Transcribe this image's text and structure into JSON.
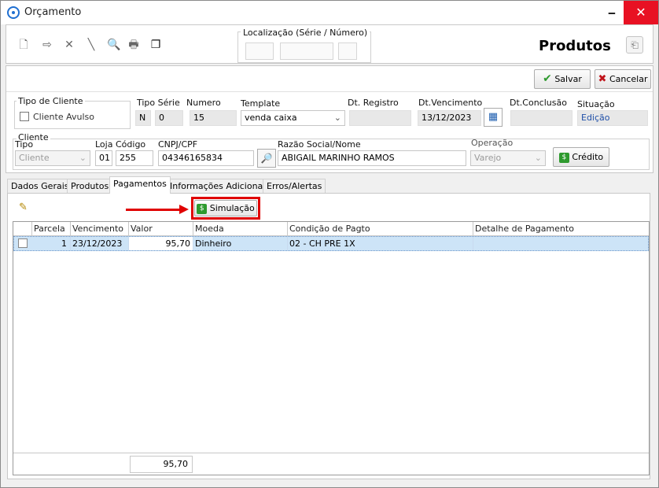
{
  "window": {
    "title": "Orçamento",
    "minimize": "🗕",
    "maximize": "🗖",
    "close": "✕"
  },
  "toolbar": {
    "localizacao_label": "Localização (Série / Número)",
    "section_title": "Produtos"
  },
  "actions": {
    "save_label": "Salvar",
    "cancel_label": "Cancelar"
  },
  "header": {
    "tipo_cliente_label": "Tipo de Cliente",
    "cliente_avulso_label": "Cliente Avulso",
    "tipo_serie_label": "Tipo Série",
    "tipo_serie_value": "N",
    "serie_value": "0",
    "numero_label": "Numero",
    "numero_value": "15",
    "template_label": "Template",
    "template_value": "venda caixa",
    "dt_registro_label": "Dt. Registro",
    "dt_registro_value": "",
    "dt_vencimento_label": "Dt.Vencimento",
    "dt_vencimento_value": "13/12/2023",
    "dt_conclusao_label": "Dt.Conclusão",
    "dt_conclusao_value": "",
    "situacao_label": "Situação",
    "situacao_value": "Edição"
  },
  "cliente": {
    "group_label": "Cliente",
    "tipo_label": "Tipo",
    "tipo_value": "Cliente",
    "loja_label": "Loja",
    "loja_value": "01",
    "codigo_label": "Código",
    "codigo_value": "255",
    "cnpj_label": "CNPJ/CPF",
    "cnpj_value": "04346165834",
    "razao_label": "Razão Social/Nome",
    "razao_value": "ABIGAIL MARINHO RAMOS",
    "operacao_label": "Operação",
    "operacao_value": "Varejo",
    "credito_label": "Crédito"
  },
  "tabs": [
    "Dados Gerais",
    "Produtos",
    "Pagamentos",
    "Informações Adicionais",
    "Erros/Alertas"
  ],
  "pagamentos": {
    "simulacao_label": "Simulação",
    "columns": [
      "Parcela",
      "Vencimento",
      "Valor",
      "Moeda",
      "Condição de Pagto",
      "Detalhe de Pagamento"
    ],
    "rows": [
      {
        "parcela": "1",
        "vencimento": "23/12/2023",
        "valor": "95,70",
        "moeda": "Dinheiro",
        "condicao": "02 - CH PRE 1X",
        "detalhe": ""
      }
    ],
    "total_valor": "95,70"
  },
  "colors": {
    "highlight_box": "#e00000",
    "selected_row": "#cde4f7",
    "close_button": "#e81123",
    "money_icon": "#2e9a2e"
  }
}
